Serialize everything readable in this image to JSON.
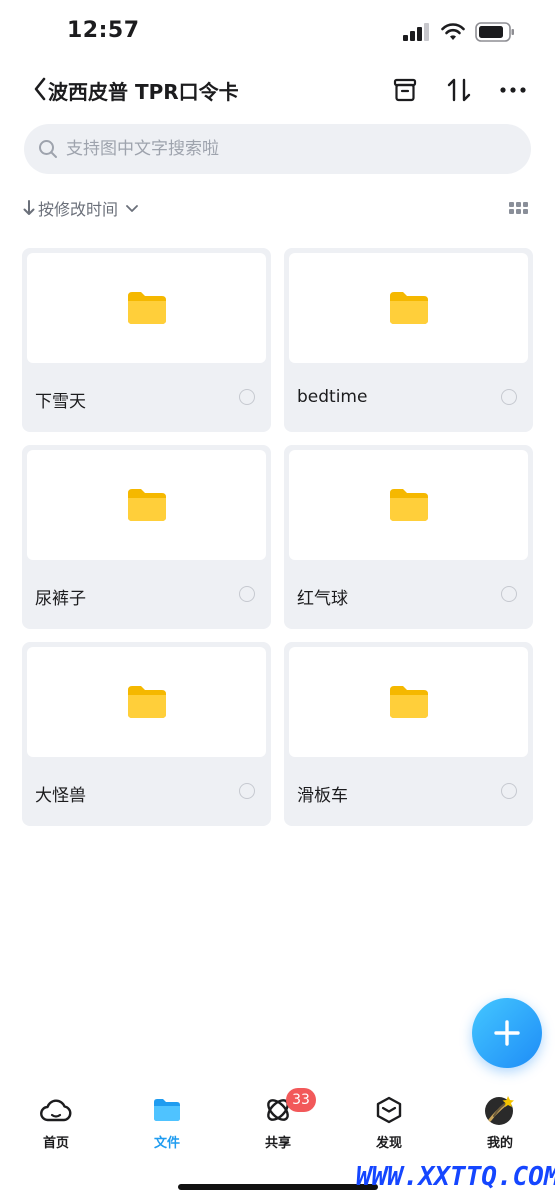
{
  "status_bar": {
    "time": "12:57"
  },
  "header": {
    "title": "波西皮普 TPR口令卡"
  },
  "search": {
    "placeholder": "支持图中文字搜索啦"
  },
  "sort": {
    "label": "按修改时间"
  },
  "folders": [
    {
      "name": "下雪天"
    },
    {
      "name": "bedtime"
    },
    {
      "name": "尿裤子"
    },
    {
      "name": "红气球"
    },
    {
      "name": "大怪兽"
    },
    {
      "name": "滑板车"
    }
  ],
  "tabs": [
    {
      "label": "首页",
      "icon": "cloud-icon"
    },
    {
      "label": "文件",
      "icon": "folder-icon"
    },
    {
      "label": "共享",
      "icon": "orbit-icon",
      "badge": "33"
    },
    {
      "label": "发现",
      "icon": "cube-icon"
    },
    {
      "label": "我的",
      "icon": "avatar"
    }
  ],
  "watermark": "WWW.XXTTQ.COM",
  "colors": {
    "accent": "#1f9cf0",
    "folder": "#ffcb2e",
    "badge": "#f2595a"
  }
}
